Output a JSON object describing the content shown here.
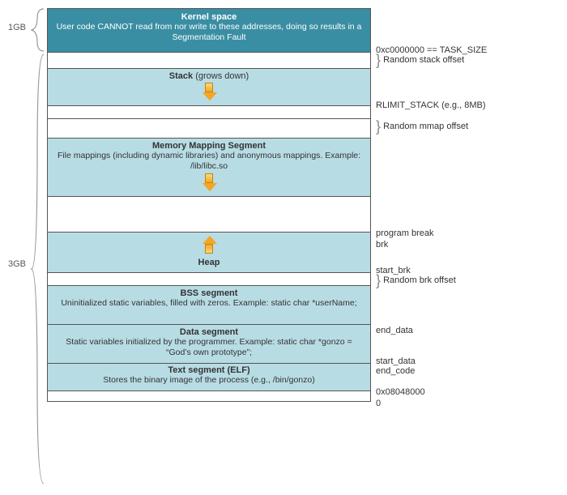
{
  "left": {
    "top_size": "1GB",
    "bottom_size": "3GB"
  },
  "segments": {
    "kernel": {
      "title": "Kernel space",
      "desc": "User code CANNOT read from nor write to these addresses, doing so results in a Segmentation Fault"
    },
    "stack_gap": {
      "label": "Random stack offset"
    },
    "stack": {
      "title": "Stack",
      "suffix": "(grows down)"
    },
    "rlimit": {
      "label": "RLIMIT_STACK (e.g., 8MB)"
    },
    "mmap_gap": {
      "label": "Random mmap offset"
    },
    "mmap": {
      "title": "Memory Mapping Segment",
      "desc": "File mappings (including dynamic libraries) and anonymous mappings. Example: /lib/libc.so"
    },
    "heap_gap_top": {
      "label1": "program break",
      "label2": "brk"
    },
    "heap": {
      "title": "Heap",
      "start_label": "start_brk"
    },
    "brk_gap": {
      "label": "Random brk offset"
    },
    "bss": {
      "title": "BSS segment",
      "desc": "Uninitialized static variables, filled with zeros. Example: static char *userName;"
    },
    "data": {
      "title": "Data segment",
      "desc": "Static variables initialized by the programmer. Example: static char *gonzo = “God’s own prototype”;",
      "top_label": "end_data",
      "bot_label": "start_data"
    },
    "text": {
      "title": "Text segment (ELF)",
      "desc": "Stores the binary image of the process (e.g., /bin/gonzo)",
      "top_label": "end_code",
      "addr": "0x08048000"
    },
    "zero": {
      "label": "0"
    }
  },
  "top_addr": "0xc0000000 == TASK_SIZE"
}
